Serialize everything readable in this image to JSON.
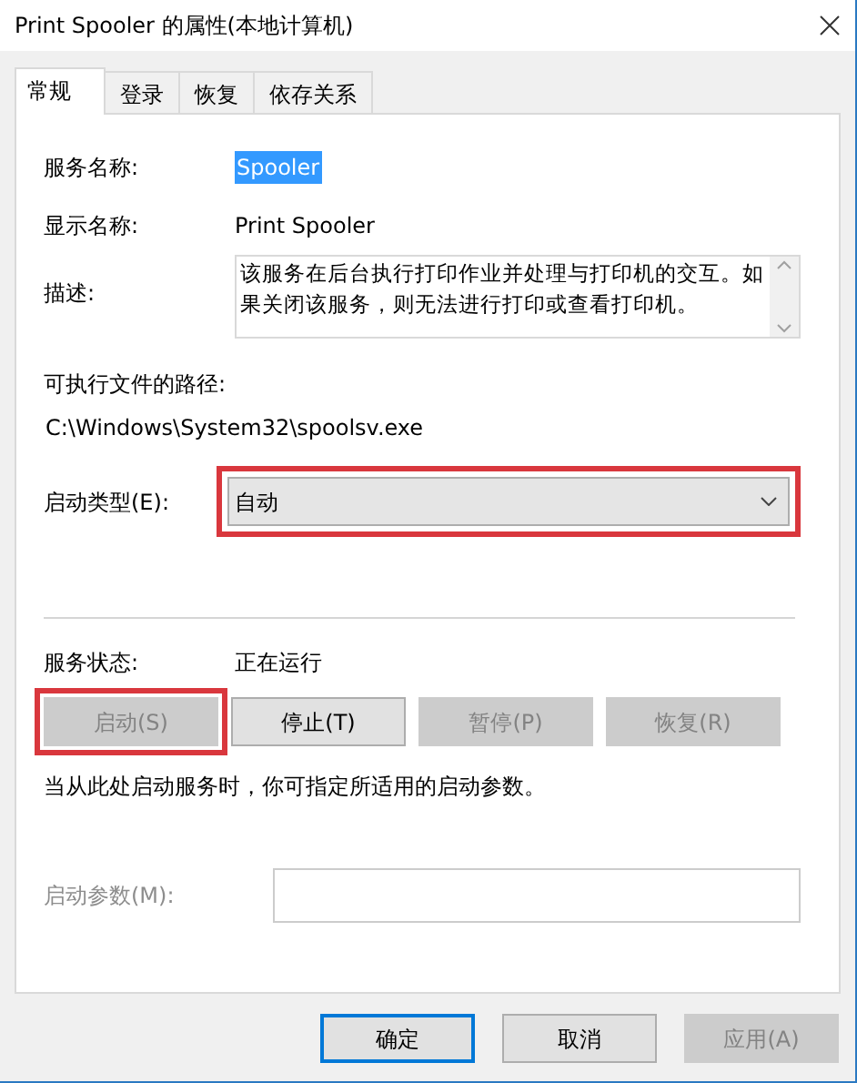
{
  "window": {
    "title": "Print Spooler 的属性(本地计算机)"
  },
  "tabs": [
    {
      "label": "常规",
      "selected": true
    },
    {
      "label": "登录",
      "selected": false
    },
    {
      "label": "恢复",
      "selected": false
    },
    {
      "label": "依存关系",
      "selected": false
    }
  ],
  "service_name": {
    "label": "服务名称:",
    "value": "Spooler",
    "selected": true
  },
  "display_name": {
    "label": "显示名称:",
    "value": "Print Spooler"
  },
  "description": {
    "label": "描述:",
    "value": "该服务在后台执行打印作业并处理与打印机的交互。如果关闭该服务，则无法进行打印或查看打印机。"
  },
  "executable_path": {
    "label": "可执行文件的路径:",
    "value": "C:\\Windows\\System32\\spoolsv.exe"
  },
  "startup_type": {
    "label": "启动类型(E):",
    "value": "自动",
    "highlighted": true
  },
  "service_status": {
    "label": "服务状态:",
    "value": "正在运行"
  },
  "service_buttons": [
    {
      "label": "启动(S)",
      "disabled": true,
      "highlighted": true
    },
    {
      "label": "停止(T)",
      "disabled": false,
      "highlighted": false
    },
    {
      "label": "暂停(P)",
      "disabled": true,
      "highlighted": false
    },
    {
      "label": "恢复(R)",
      "disabled": true,
      "highlighted": false
    }
  ],
  "hint": "当从此处启动服务时，你可指定所适用的启动参数。",
  "start_parameters": {
    "label": "启动参数(M):",
    "disabled": true
  },
  "dialog_buttons": [
    {
      "label": "确定",
      "default": true,
      "disabled": false
    },
    {
      "label": "取消",
      "default": false,
      "disabled": false
    },
    {
      "label": "应用(A)",
      "default": false,
      "disabled": true
    }
  ]
}
